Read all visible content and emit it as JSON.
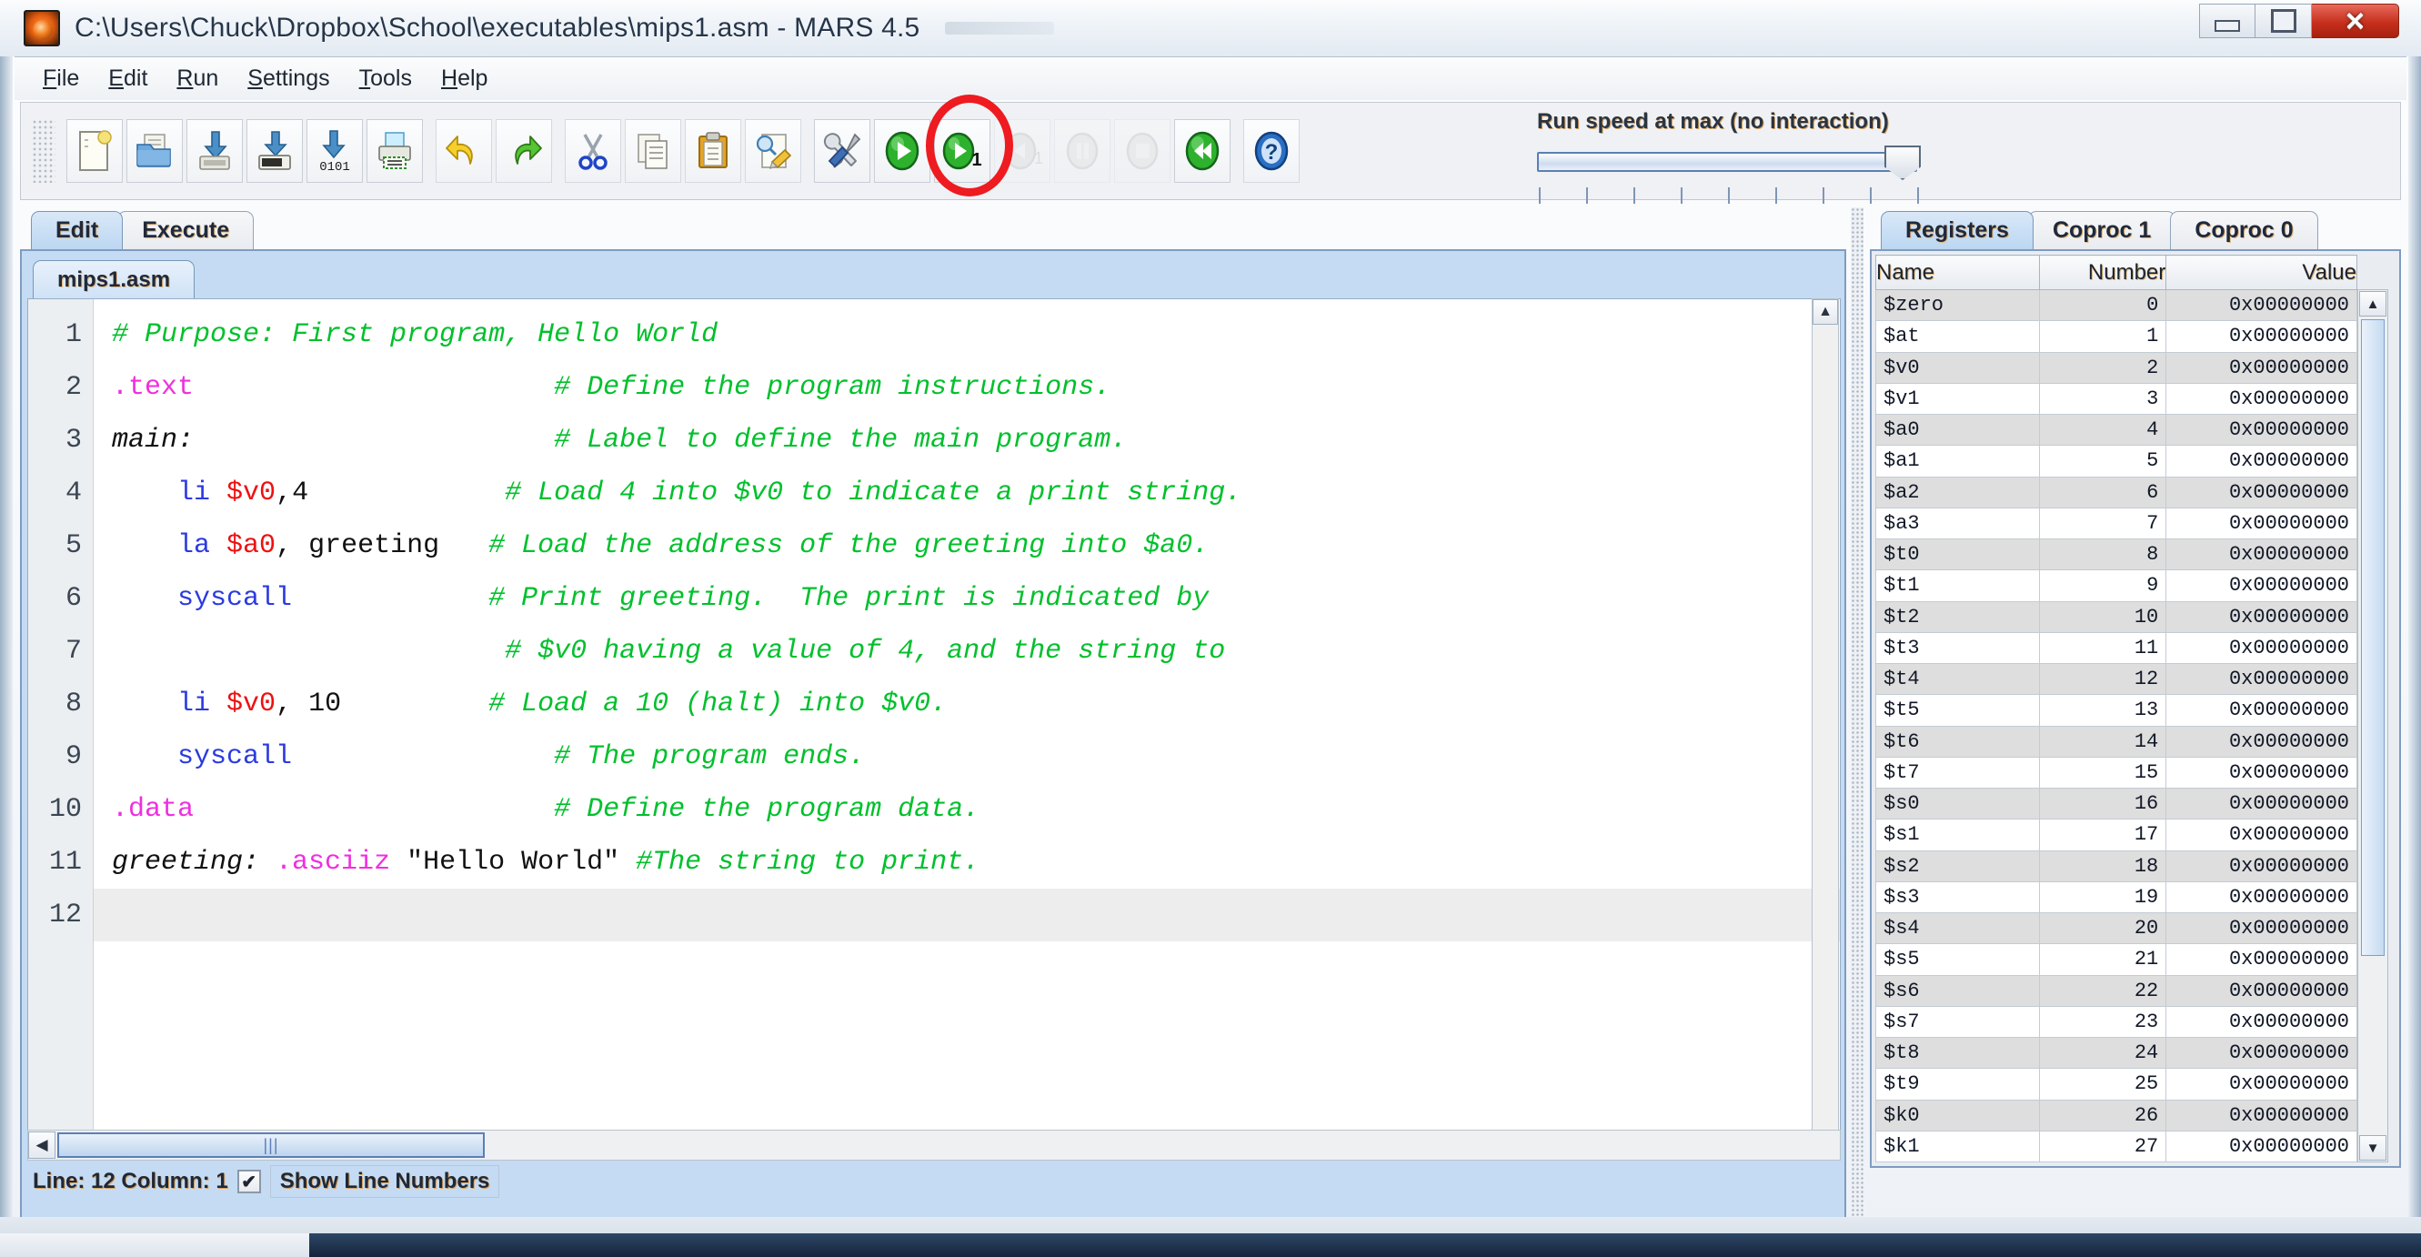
{
  "window": {
    "title": "C:\\Users\\Chuck\\Dropbox\\School\\executables\\mips1.asm  - MARS 4.5",
    "app_icon": "mars-planet-icon",
    "controls": {
      "minimize": "–",
      "maximize": "□",
      "close": "✕"
    }
  },
  "menu": {
    "items": [
      {
        "label": "File",
        "mnemonic": "F"
      },
      {
        "label": "Edit",
        "mnemonic": "E"
      },
      {
        "label": "Run",
        "mnemonic": "R"
      },
      {
        "label": "Settings",
        "mnemonic": "S"
      },
      {
        "label": "Tools",
        "mnemonic": "T"
      },
      {
        "label": "Help",
        "mnemonic": "H"
      }
    ]
  },
  "toolbar": {
    "buttons": [
      {
        "name": "new-file-icon",
        "tip": "New",
        "enabled": true
      },
      {
        "name": "open-folder-icon",
        "tip": "Open",
        "enabled": true
      },
      {
        "name": "save-icon",
        "tip": "Save",
        "enabled": true
      },
      {
        "name": "save-as-icon",
        "tip": "Save As",
        "enabled": true
      },
      {
        "name": "dump-memory-icon",
        "tip": "Dump Memory",
        "enabled": true,
        "glyph": "0101"
      },
      {
        "name": "print-icon",
        "tip": "Print",
        "enabled": true
      },
      {
        "name": "undo-icon",
        "tip": "Undo",
        "enabled": true
      },
      {
        "name": "redo-icon",
        "tip": "Redo",
        "enabled": true
      },
      {
        "name": "cut-icon",
        "tip": "Cut",
        "enabled": true
      },
      {
        "name": "copy-icon",
        "tip": "Copy",
        "enabled": true
      },
      {
        "name": "paste-icon",
        "tip": "Paste",
        "enabled": true
      },
      {
        "name": "find-replace-icon",
        "tip": "Find/Replace",
        "enabled": true
      },
      {
        "name": "assemble-icon",
        "tip": "Assemble",
        "enabled": true,
        "highlighted": true
      },
      {
        "name": "run-icon",
        "tip": "Run",
        "enabled": true
      },
      {
        "name": "step-icon",
        "tip": "Step",
        "enabled": true,
        "glyph": "1"
      },
      {
        "name": "backstep-icon",
        "tip": "Backstep",
        "enabled": false,
        "glyph": "1"
      },
      {
        "name": "pause-icon",
        "tip": "Pause",
        "enabled": false
      },
      {
        "name": "stop-icon",
        "tip": "Stop",
        "enabled": false
      },
      {
        "name": "reset-icon",
        "tip": "Reset",
        "enabled": true
      },
      {
        "name": "help-icon",
        "tip": "Help",
        "enabled": true
      }
    ]
  },
  "run_speed": {
    "label": "Run speed at max (no interaction)",
    "value": 100,
    "tick_count": 9
  },
  "tabs": {
    "main": [
      {
        "label": "Edit",
        "active": true
      },
      {
        "label": "Execute",
        "active": false
      }
    ],
    "files": [
      {
        "label": "mips1.asm",
        "active": true
      }
    ]
  },
  "editor": {
    "line_count": 12,
    "line_numbers": [
      "1",
      "2",
      "3",
      "4",
      "5",
      "6",
      "7",
      "8",
      "9",
      "10",
      "11",
      "12"
    ],
    "lines": [
      {
        "n": 1,
        "tokens": [
          {
            "t": "comment",
            "s": "# Purpose: First program, Hello World"
          }
        ]
      },
      {
        "n": 2,
        "tokens": [
          {
            "t": "directive",
            "s": ".text"
          },
          {
            "t": "plain",
            "s": "                      "
          },
          {
            "t": "comment",
            "s": "# Define the program instructions."
          }
        ]
      },
      {
        "n": 3,
        "tokens": [
          {
            "t": "label",
            "s": "main:"
          },
          {
            "t": "plain",
            "s": "                      "
          },
          {
            "t": "comment",
            "s": "# Label to define the main program."
          }
        ]
      },
      {
        "n": 4,
        "tokens": [
          {
            "t": "plain",
            "s": "    "
          },
          {
            "t": "instr",
            "s": "li"
          },
          {
            "t": "plain",
            "s": " "
          },
          {
            "t": "reg",
            "s": "$v0"
          },
          {
            "t": "plain",
            "s": ",4"
          },
          {
            "t": "plain",
            "s": "            "
          },
          {
            "t": "comment",
            "s": "# Load 4 into $v0 to indicate a print string."
          }
        ]
      },
      {
        "n": 5,
        "tokens": [
          {
            "t": "plain",
            "s": "    "
          },
          {
            "t": "instr",
            "s": "la"
          },
          {
            "t": "plain",
            "s": " "
          },
          {
            "t": "reg",
            "s": "$a0"
          },
          {
            "t": "plain",
            "s": ", greeting"
          },
          {
            "t": "plain",
            "s": "   "
          },
          {
            "t": "comment",
            "s": "# Load the address of the greeting into $a0."
          }
        ]
      },
      {
        "n": 6,
        "tokens": [
          {
            "t": "plain",
            "s": "    "
          },
          {
            "t": "instr",
            "s": "syscall"
          },
          {
            "t": "plain",
            "s": "            "
          },
          {
            "t": "comment",
            "s": "# Print greeting.  The print is indicated by"
          }
        ]
      },
      {
        "n": 7,
        "tokens": [
          {
            "t": "plain",
            "s": "                        "
          },
          {
            "t": "comment",
            "s": "# $v0 having a value of 4, and the string to"
          }
        ]
      },
      {
        "n": 8,
        "tokens": [
          {
            "t": "plain",
            "s": "    "
          },
          {
            "t": "instr",
            "s": "li"
          },
          {
            "t": "plain",
            "s": " "
          },
          {
            "t": "reg",
            "s": "$v0"
          },
          {
            "t": "plain",
            "s": ", 10"
          },
          {
            "t": "plain",
            "s": "         "
          },
          {
            "t": "comment",
            "s": "# Load a 10 (halt) into $v0."
          }
        ]
      },
      {
        "n": 9,
        "tokens": [
          {
            "t": "plain",
            "s": "    "
          },
          {
            "t": "instr",
            "s": "syscall"
          },
          {
            "t": "plain",
            "s": "                "
          },
          {
            "t": "comment",
            "s": "# The program ends."
          }
        ]
      },
      {
        "n": 10,
        "tokens": [
          {
            "t": "directive",
            "s": ".data"
          },
          {
            "t": "plain",
            "s": "                      "
          },
          {
            "t": "comment",
            "s": "# Define the program data."
          }
        ]
      },
      {
        "n": 11,
        "tokens": [
          {
            "t": "label",
            "s": "greeting:"
          },
          {
            "t": "plain",
            "s": " "
          },
          {
            "t": "directive",
            "s": ".asciiz"
          },
          {
            "t": "plain",
            "s": " \"Hello World\" "
          },
          {
            "t": "comment",
            "s": "#The string to print."
          }
        ]
      },
      {
        "n": 12,
        "tokens": [
          {
            "t": "plain",
            "s": ""
          }
        ]
      }
    ]
  },
  "status": {
    "position": "Line: 12 Column: 1",
    "show_line_numbers_label": "Show Line Numbers",
    "show_line_numbers_checked": true,
    "checkmark": "✔"
  },
  "registers_panel": {
    "tabs": [
      {
        "label": "Registers",
        "active": true
      },
      {
        "label": "Coproc 1",
        "active": false
      },
      {
        "label": "Coproc 0",
        "active": false
      }
    ],
    "columns": [
      "Name",
      "Number",
      "Value"
    ],
    "rows": [
      {
        "name": "$zero",
        "number": "0",
        "value": "0x00000000"
      },
      {
        "name": "$at",
        "number": "1",
        "value": "0x00000000"
      },
      {
        "name": "$v0",
        "number": "2",
        "value": "0x00000000"
      },
      {
        "name": "$v1",
        "number": "3",
        "value": "0x00000000"
      },
      {
        "name": "$a0",
        "number": "4",
        "value": "0x00000000"
      },
      {
        "name": "$a1",
        "number": "5",
        "value": "0x00000000"
      },
      {
        "name": "$a2",
        "number": "6",
        "value": "0x00000000"
      },
      {
        "name": "$a3",
        "number": "7",
        "value": "0x00000000"
      },
      {
        "name": "$t0",
        "number": "8",
        "value": "0x00000000"
      },
      {
        "name": "$t1",
        "number": "9",
        "value": "0x00000000"
      },
      {
        "name": "$t2",
        "number": "10",
        "value": "0x00000000"
      },
      {
        "name": "$t3",
        "number": "11",
        "value": "0x00000000"
      },
      {
        "name": "$t4",
        "number": "12",
        "value": "0x00000000"
      },
      {
        "name": "$t5",
        "number": "13",
        "value": "0x00000000"
      },
      {
        "name": "$t6",
        "number": "14",
        "value": "0x00000000"
      },
      {
        "name": "$t7",
        "number": "15",
        "value": "0x00000000"
      },
      {
        "name": "$s0",
        "number": "16",
        "value": "0x00000000"
      },
      {
        "name": "$s1",
        "number": "17",
        "value": "0x00000000"
      },
      {
        "name": "$s2",
        "number": "18",
        "value": "0x00000000"
      },
      {
        "name": "$s3",
        "number": "19",
        "value": "0x00000000"
      },
      {
        "name": "$s4",
        "number": "20",
        "value": "0x00000000"
      },
      {
        "name": "$s5",
        "number": "21",
        "value": "0x00000000"
      },
      {
        "name": "$s6",
        "number": "22",
        "value": "0x00000000"
      },
      {
        "name": "$s7",
        "number": "23",
        "value": "0x00000000"
      },
      {
        "name": "$t8",
        "number": "24",
        "value": "0x00000000"
      },
      {
        "name": "$t9",
        "number": "25",
        "value": "0x00000000"
      },
      {
        "name": "$k0",
        "number": "26",
        "value": "0x00000000"
      },
      {
        "name": "$k1",
        "number": "27",
        "value": "0x00000000"
      }
    ]
  },
  "colors": {
    "comment": "#00c02c",
    "directive": "#ef2fe0",
    "instruction": "#2b3ae0",
    "register": "#ee1111",
    "plain": "#111111",
    "highlight_ring": "#ee1b20",
    "tab_active": "#bcd7f2",
    "editor_chrome": "#c4dbf3"
  }
}
